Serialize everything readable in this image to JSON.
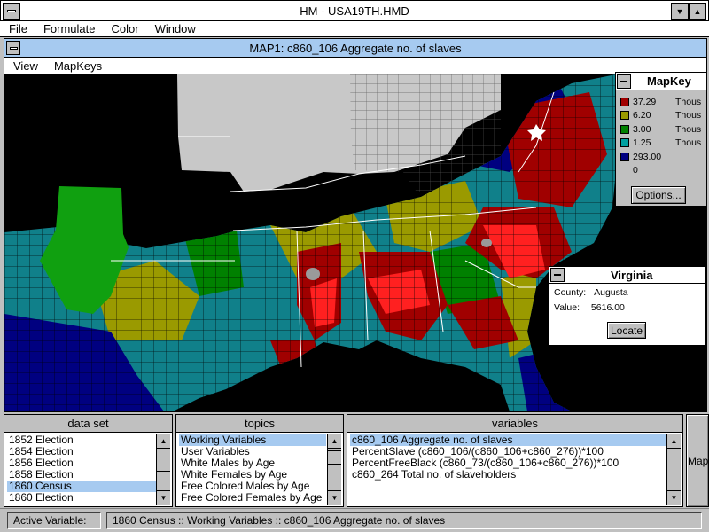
{
  "app": {
    "title": "HM - USA19TH.HMD",
    "menu": [
      "File",
      "Formulate",
      "Color",
      "Window"
    ]
  },
  "map_window": {
    "title": "MAP1: c860_106 Aggregate no. of slaves",
    "menu": [
      "View",
      "MapKeys"
    ]
  },
  "mapkey": {
    "title": "MapKey",
    "entries": [
      {
        "value": "37.29",
        "unit": "Thous",
        "color": "#a00000"
      },
      {
        "value": "6.20",
        "unit": "Thous",
        "color": "#9a9a00"
      },
      {
        "value": "3.00",
        "unit": "Thous",
        "color": "#008000"
      },
      {
        "value": "1.25",
        "unit": "Thous",
        "color": "#00a0a0"
      },
      {
        "value": "293.00",
        "unit": "",
        "color": "#000080"
      },
      {
        "value": "0",
        "unit": "",
        "color": ""
      }
    ],
    "options_label": "Options..."
  },
  "info": {
    "title": "Virginia",
    "county_label": "County:",
    "county_value": "Augusta",
    "value_label": "Value:",
    "value_value": "5616.00",
    "locate_label": "Locate"
  },
  "dataset": {
    "header": "data set",
    "items": [
      "1852 Election",
      "1854 Election",
      "1856 Election",
      "1858 Election",
      "1860 Census",
      "1860 Election"
    ],
    "selected": 4
  },
  "topics": {
    "header": "topics",
    "items": [
      "Working Variables",
      "User Variables",
      "White Males by Age",
      "White Females by Age",
      "Free Colored Males by Age",
      "Free Colored Females by Age"
    ],
    "selected": 0
  },
  "variables": {
    "header": "variables",
    "items": [
      "c860_106 Aggregate no. of slaves",
      "PercentSlave (c860_106/(c860_106+c860_276))*100",
      "PercentFreeBlack (c860_73/(c860_106+c860_276))*100",
      "c860_264 Total no. of slaveholders"
    ],
    "selected": 0
  },
  "map_button_label": "Map",
  "status": {
    "label": "Active Variable:",
    "value": "1860 Census :: Working Variables :: c860_106 Aggregate no. of slaves"
  },
  "colors": {
    "selection": "#a6caf0",
    "high_red": "#ff2020",
    "northern_grey": "#c8c8c8",
    "texas_green": "#10a010"
  }
}
